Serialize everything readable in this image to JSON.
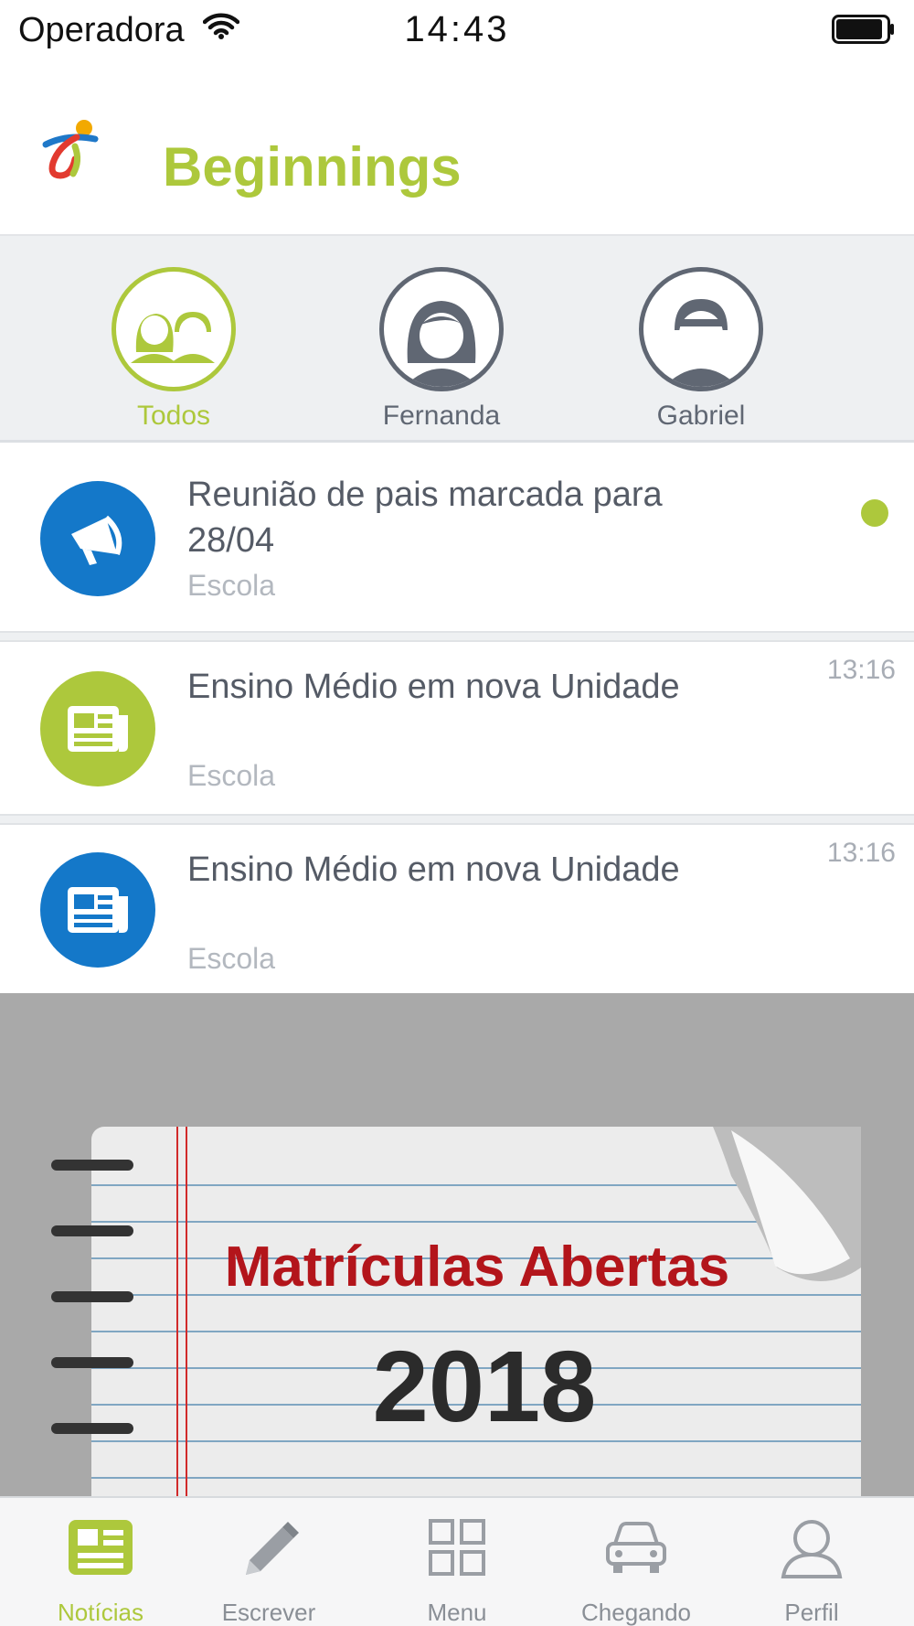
{
  "status_bar": {
    "carrier": "Operadora",
    "time": "14:43",
    "wifi_icon": "wifi-icon",
    "battery_icon": "battery-icon"
  },
  "header": {
    "title": "Beginnings",
    "logo_icon": "beginnings-logo-icon",
    "title_color": "#adc83c"
  },
  "children": [
    {
      "label": "Todos",
      "icon": "group-avatar-icon",
      "active": true
    },
    {
      "label": "Fernanda",
      "icon": "girl-avatar-icon",
      "active": false
    },
    {
      "label": "Gabriel",
      "icon": "boy-avatar-icon",
      "active": false
    }
  ],
  "feed": [
    {
      "title": "Reunião de pais marcada para 28/04",
      "source": "Escola",
      "time": "",
      "unread": true,
      "icon": "megaphone-icon",
      "icon_color": "#1478c9"
    },
    {
      "title": "Ensino Médio em nova Unidade",
      "source": "Escola",
      "time": "13:16",
      "unread": false,
      "icon": "newspaper-icon",
      "icon_color": "#adc83c"
    },
    {
      "title": "Ensino Médio em nova Unidade",
      "source": "Escola",
      "time": "13:16",
      "unread": false,
      "icon": "newspaper-icon",
      "icon_color": "#1478c9"
    }
  ],
  "banner": {
    "headline": "Matrículas Abertas",
    "year": "2018",
    "headline_color": "#b3151b"
  },
  "tab_bar": {
    "tabs": [
      {
        "label": "Notícias",
        "icon": "news-icon",
        "active": true
      },
      {
        "label": "Escrever",
        "icon": "pencil-icon",
        "active": false
      },
      {
        "label": "Menu",
        "icon": "grid-icon",
        "active": false
      },
      {
        "label": "Chegando",
        "icon": "car-icon",
        "active": false
      },
      {
        "label": "Perfil",
        "icon": "person-icon",
        "active": false
      }
    ]
  },
  "colors": {
    "accent_green": "#adc83c",
    "accent_blue": "#1478c9",
    "text_dark": "#555b66",
    "text_muted": "#b3b8bf"
  }
}
